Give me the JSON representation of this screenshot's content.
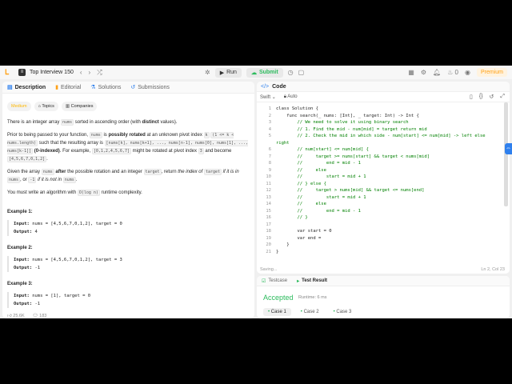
{
  "topbar": {
    "list_title": "Top Interview 150",
    "run_label": "Run",
    "submit_label": "Submit",
    "badge_count": "0",
    "premium_label": "Premium"
  },
  "left_tabs": [
    {
      "label": "Description"
    },
    {
      "label": "Editorial"
    },
    {
      "label": "Solutions"
    },
    {
      "label": "Submissions"
    }
  ],
  "tags": [
    "Medium",
    "Topics",
    "Companies"
  ],
  "description": {
    "p1a": "There is an integer array ",
    "p1code": "nums",
    "p1b": " sorted in ascending order (with ",
    "p1bold": "distinct",
    "p1c": " values).",
    "p2a": "Prior to being passed to your function, ",
    "p2code1": "nums",
    "p2b": " is ",
    "p2bold1": "possibly rotated",
    "p2c": " at an unknown pivot index ",
    "p2code2": "k",
    "p2code3": "(1 <= k < nums.length)",
    "p2d": " such that the resulting array is ",
    "p2code4": "[nums[k], nums[k+1], ..., nums[n-1], nums[0], nums[1], ..., nums[k-1]]",
    "p2bold2": "(0-indexed)",
    "p2e": ". For example, ",
    "p2code5": "[0,1,2,4,5,6,7]",
    "p2f": " might be rotated at pivot index ",
    "p2code6": "3",
    "p2g": " and become ",
    "p2code7": "[4,5,6,7,0,1,2]",
    "p2h": ".",
    "p3a": "Given the array ",
    "p3code1": "nums",
    "p3bold": "after",
    "p3b": " the possible rotation and an integer ",
    "p3code2": "target",
    "p3c": ", return ",
    "p3i1": "the index of ",
    "p3code3": "target",
    "p3i2": " if it is in ",
    "p3code4": "nums",
    "p3d": ", or ",
    "p3code5": "-1",
    "p3i3": " if it is not in ",
    "p3code6": "nums",
    "p3e": ".",
    "p4a": "You must write an algorithm with ",
    "p4code": "O(log n)",
    "p4b": " runtime complexity."
  },
  "examples": [
    {
      "title": "Example 1:",
      "input": "nums = [4,5,6,7,0,1,2], target = 0",
      "output": "4"
    },
    {
      "title": "Example 2:",
      "input": "nums = [4,5,6,7,0,1,2], target = 3",
      "output": "-1"
    },
    {
      "title": "Example 3:",
      "input": "nums = [1], target = 0",
      "output": "-1"
    }
  ],
  "example_labels": {
    "input": "Input:",
    "output": "Output:"
  },
  "stats": {
    "likes": "25.6K",
    "comments": "183"
  },
  "code_panel": {
    "title": "Code",
    "language": "Swift",
    "mode": "Auto",
    "status_left": "Saving...",
    "status_right": "Ln 2, Col 23"
  },
  "code_lines": [
    "class Solution {",
    "    func search(_ nums: [Int], _ target: Int) -> Int {",
    "        // We need to solve it using binary search",
    "        // 1. Find the mid - num[mid] = target return mid",
    "        // 2. Check the mid in which side - num[start] <= num[mid] -> left else",
    "right",
    "        // num[start] <= num[mid] {",
    "        //     target >= nums[start] && target < nums[mid]",
    "        //         end = mid - 1",
    "        //     else",
    "        //         start = mid + 1",
    "        // } else {",
    "        //     target > nums[mid] && target <= nums[end]",
    "        //         start = mid + 1",
    "        //     else",
    "        //         end = mid - 1",
    "        // }",
    "",
    "        var start = 0",
    "        var end =",
    "    }",
    "}"
  ],
  "line_numbers": [
    "1",
    "2",
    "3",
    "4",
    "5",
    "",
    "6",
    "7",
    "8",
    "9",
    "10",
    "11",
    "12",
    "13",
    "14",
    "15",
    "16",
    "17",
    "18",
    "19",
    "20",
    "21"
  ],
  "test_panel": {
    "tab_testcase": "Testcase",
    "tab_result": "Test Result",
    "verdict": "Accepted",
    "runtime": "Runtime: 6 ms",
    "cases": [
      "Case 1",
      "Case 2",
      "Case 3"
    ]
  }
}
